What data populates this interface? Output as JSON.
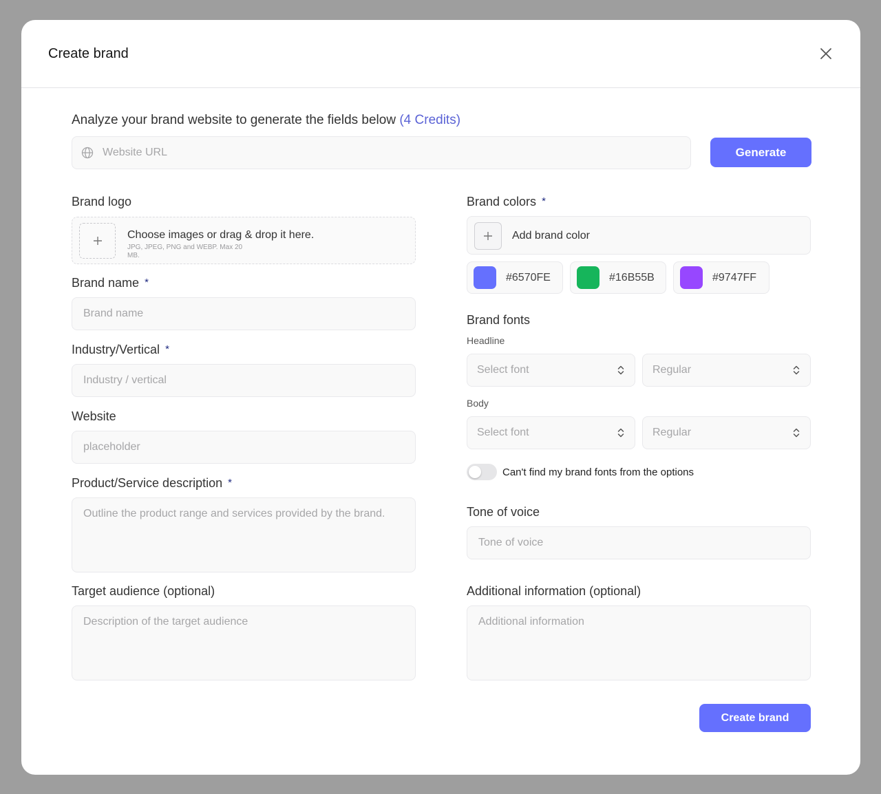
{
  "dialog": {
    "title": "Create brand"
  },
  "analyze": {
    "prompt": "Analyze your brand website to generate the fields below",
    "credits": "(4 Credits)",
    "url_placeholder": "Website URL",
    "generate_label": "Generate"
  },
  "brand_logo": {
    "label": "Brand logo",
    "upload_title": "Choose images or drag & drop it here.",
    "upload_hint": "JPG, JPEG, PNG and WEBP. Max 20 MB."
  },
  "brand_name": {
    "label": "Brand name",
    "required_mark": "*",
    "placeholder": "Brand name"
  },
  "industry": {
    "label": "Industry/Vertical",
    "required_mark": "*",
    "placeholder": "Industry / vertical"
  },
  "website": {
    "label": "Website",
    "placeholder": "placeholder"
  },
  "description": {
    "label": "Product/Service description",
    "required_mark": "*",
    "placeholder": "Outline the product range and services provided by the brand."
  },
  "audience": {
    "label": "Target audience (optional)",
    "placeholder": "Description of the target audience"
  },
  "brand_colors": {
    "label": "Brand colors",
    "required_mark": "*",
    "add_label": "Add brand color",
    "swatches": [
      {
        "hex": "#6570FE",
        "color": "#6570fe"
      },
      {
        "hex": "#16B55B",
        "color": "#16b55b"
      },
      {
        "hex": "#9747FF",
        "color": "#9747ff"
      }
    ]
  },
  "brand_fonts": {
    "label": "Brand fonts",
    "headline": {
      "label": "Headline",
      "font_placeholder": "Select font",
      "weight": "Regular"
    },
    "body": {
      "label": "Body",
      "font_placeholder": "Select font",
      "weight": "Regular"
    },
    "toggle_label": "Can't find my brand fonts from the options",
    "toggle_on": false
  },
  "tone": {
    "label": "Tone of voice",
    "placeholder": "Tone of voice"
  },
  "additional": {
    "label": "Additional information (optional)",
    "placeholder": "Additional information"
  },
  "footer": {
    "create_label": "Create brand"
  },
  "colors": {
    "accent": "#6570fe",
    "credits": "#5b63d6",
    "required": "#1f2a80"
  }
}
